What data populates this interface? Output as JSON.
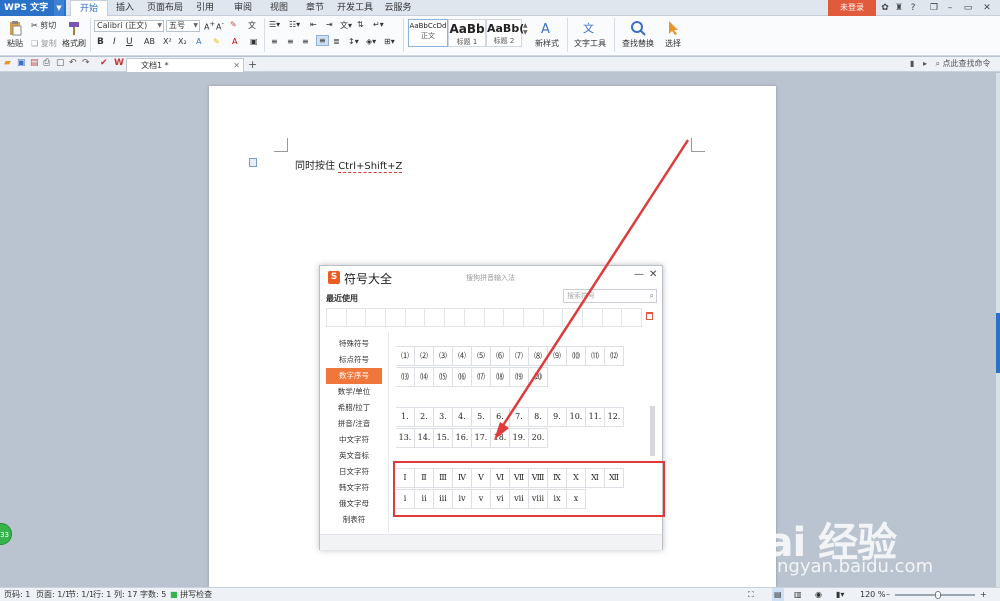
{
  "titlebar": {
    "app_name": "WPS 文字",
    "menu_tabs": [
      "开始",
      "插入",
      "页面布局",
      "引用",
      "审阅",
      "视图",
      "章节",
      "开发工具",
      "云服务"
    ],
    "active_tab": "开始",
    "login": "未登录"
  },
  "ribbon": {
    "paste": "粘贴",
    "cut": "剪切",
    "copy": "复制",
    "format_painter": "格式刷",
    "font_name": "Calibri (正文)",
    "font_size": "五号",
    "styles": [
      {
        "preview": "AaBbCcDd",
        "name": "正文"
      },
      {
        "preview": "AaBb",
        "name": "标题 1"
      },
      {
        "preview": "AaBb(",
        "name": "标题 2"
      }
    ],
    "new_style": "新样式",
    "text_tools": "文字工具",
    "find_replace": "查找替换",
    "select": "选择"
  },
  "docbar": {
    "tab_title": "文档1 *",
    "find_command": "点此查找命令"
  },
  "document": {
    "text_prefix": "同时按住 ",
    "text_keys": "Ctrl+Shift+Z"
  },
  "dialog": {
    "title": "符号大全",
    "subtitle": "搜狗拼音输入法",
    "recent_label": "最近使用",
    "search_placeholder": "搜索符号",
    "categories": [
      "特殊符号",
      "标点符号",
      "数字序号",
      "数学/单位",
      "希腊/拉丁",
      "拼音/注音",
      "中文字符",
      "英文音标",
      "日文字符",
      "韩文字符",
      "俄文字母",
      "制表符"
    ],
    "active_category": "数字序号",
    "rows": [
      [
        "⑴",
        "⑵",
        "⑶",
        "⑷",
        "⑸",
        "⑹",
        "⑺",
        "⑻",
        "⑼",
        "⑽",
        "⑾",
        "⑿"
      ],
      [
        "⒀",
        "⒁",
        "⒂",
        "⒃",
        "⒄",
        "⒅",
        "⒆",
        "⒇"
      ],
      [
        "1.",
        "2.",
        "3.",
        "4.",
        "5.",
        "6.",
        "7.",
        "8.",
        "9.",
        "10.",
        "11.",
        "12."
      ],
      [
        "13.",
        "14.",
        "15.",
        "16.",
        "17.",
        "18.",
        "19.",
        "20."
      ],
      [
        "Ⅰ",
        "Ⅱ",
        "Ⅲ",
        "Ⅳ",
        "Ⅴ",
        "Ⅵ",
        "Ⅶ",
        "Ⅷ",
        "Ⅸ",
        "Ⅹ",
        "Ⅺ",
        "Ⅻ"
      ],
      [
        "ⅰ",
        "ⅱ",
        "ⅲ",
        "ⅳ",
        "ⅴ",
        "ⅵ",
        "ⅶ",
        "ⅷ",
        "ⅸ",
        "ⅹ"
      ]
    ]
  },
  "status": {
    "page_num": "页码: 1",
    "page": "页面: 1/1",
    "section": "节: 1/1",
    "row": "行: 1",
    "col": "列: 17",
    "words": "字数: 5",
    "spell": "拼写检查",
    "zoom": "120 %"
  },
  "badge": "33",
  "watermark": {
    "brand": "Bai 经验",
    "url": "jingyan.baidu.com"
  },
  "colors": {
    "accent": "#2a72c8",
    "active_category": "#f0773b",
    "highlight": "#e03b3b",
    "login": "#e25a3c"
  }
}
